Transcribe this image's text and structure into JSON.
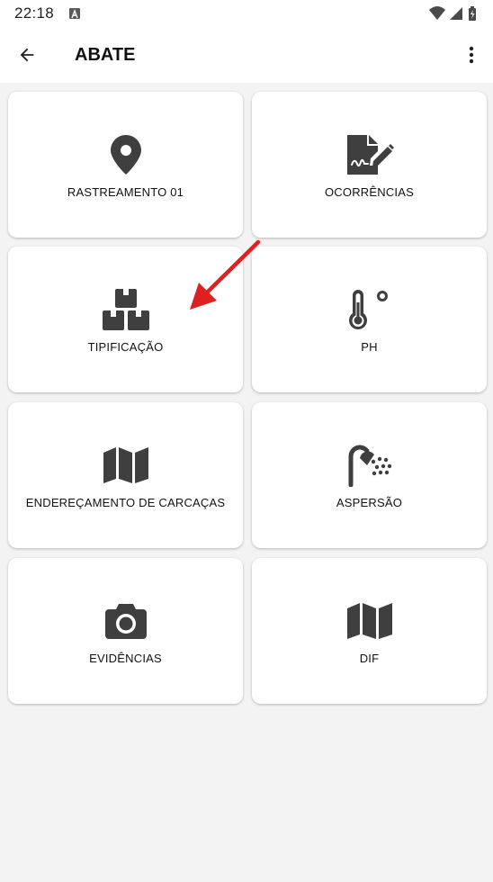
{
  "status_bar": {
    "time": "22:18"
  },
  "app_bar": {
    "title": "ABATE"
  },
  "tiles": [
    {
      "label": "RASTREAMENTO 01",
      "icon": "map-marker-icon"
    },
    {
      "label": "OCORRÊNCIAS",
      "icon": "file-signature-icon"
    },
    {
      "label": "TIPIFICAÇÃO",
      "icon": "boxes-icon"
    },
    {
      "label": "PH",
      "icon": "temperature-icon"
    },
    {
      "label": "ENDEREÇAMENTO DE CARCAÇAS",
      "icon": "map-icon"
    },
    {
      "label": "ASPERSÃO",
      "icon": "shower-icon"
    },
    {
      "label": "EVIDÊNCIAS",
      "icon": "camera-icon"
    },
    {
      "label": "DIF",
      "icon": "map-icon"
    }
  ],
  "colors": {
    "icon": "#3f3f3f",
    "annotation_arrow": "#e02020",
    "background": "#f3f3f3"
  }
}
